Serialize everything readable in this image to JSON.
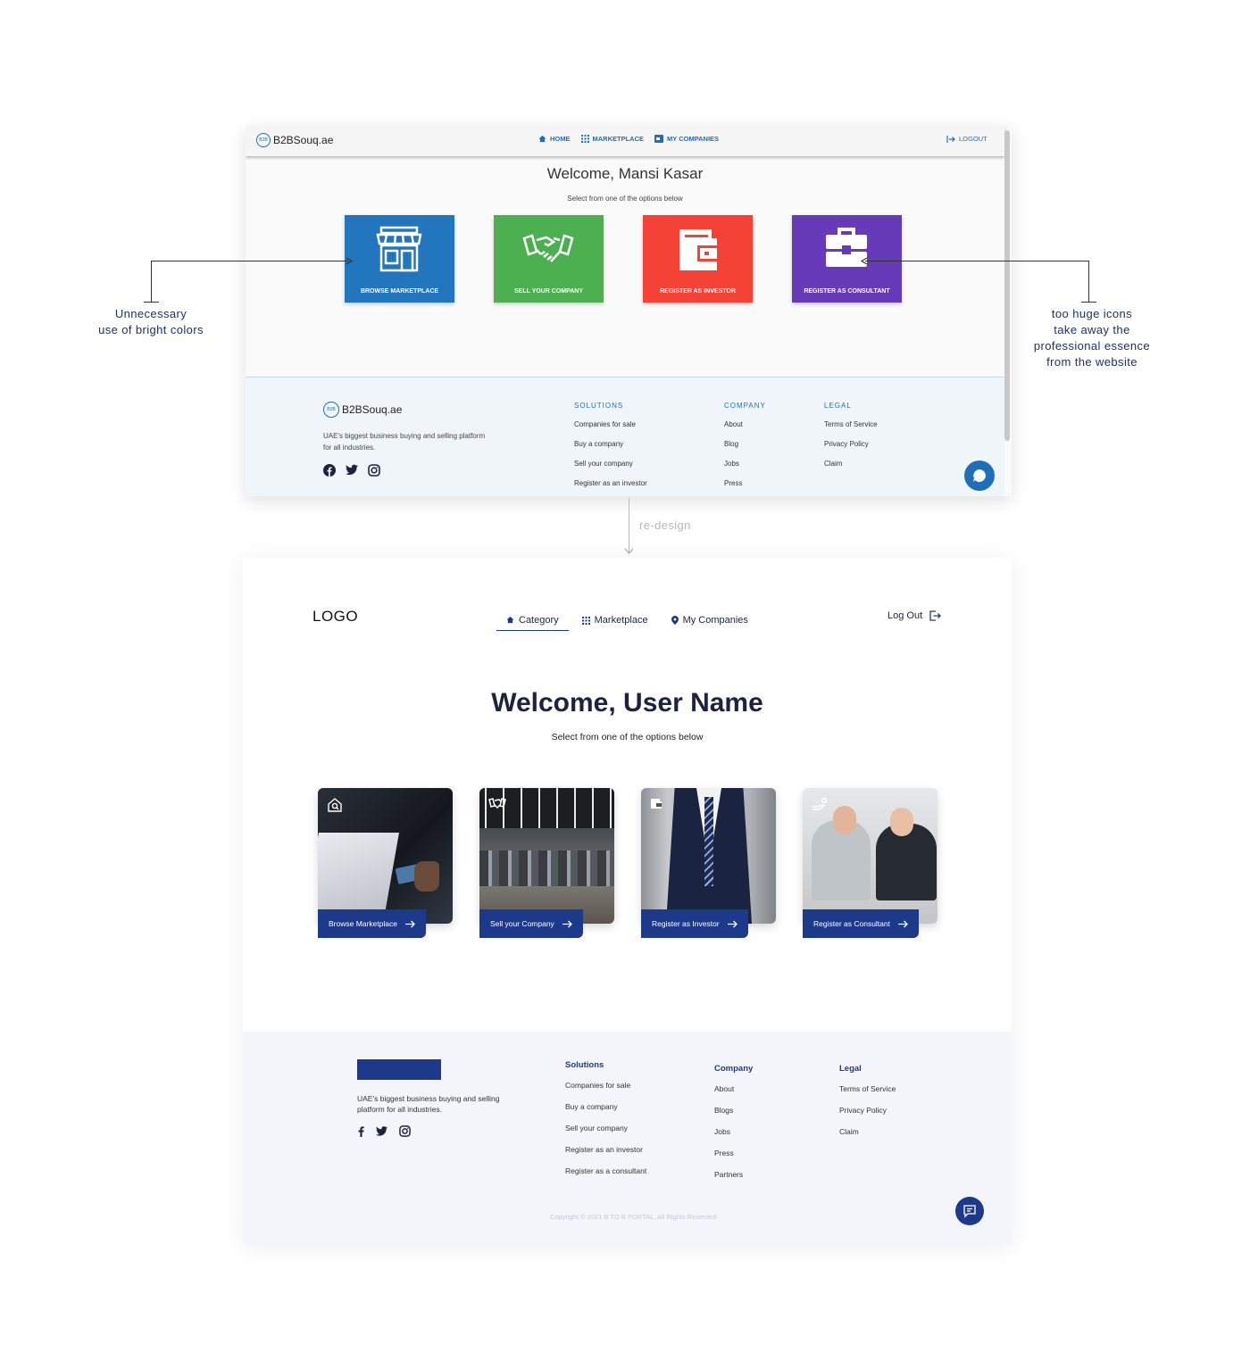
{
  "old_screen": {
    "logo": "B2BSouq.ae",
    "logo_badge": "B2B",
    "nav": {
      "home": "HOME",
      "marketplace": "MARKETPLACE",
      "my_companies": "MY COMPANIES",
      "logout": "LOGOUT"
    },
    "title": "Welcome, Mansi Kasar",
    "subtitle": "Select from one of the options below",
    "tiles": [
      {
        "label": "BROWSE MARKETPLACE",
        "color": "#2176bd",
        "icon": "storefront-icon"
      },
      {
        "label": "SELL YOUR COMPANY",
        "color": "#4caf50",
        "icon": "handshake-icon"
      },
      {
        "label": "REGISTER AS INVESTOR",
        "color": "#f44336",
        "icon": "wallet-icon"
      },
      {
        "label": "REGISTER AS CONSULTANT",
        "color": "#673ab7",
        "icon": "briefcase-icon"
      }
    ],
    "footer": {
      "logo": "B2BSouq.ae",
      "description": "UAE's biggest business buying and selling platform for all industries.",
      "solutions": {
        "heading": "SOLUTIONS",
        "items": [
          "Companies for sale",
          "Buy a company",
          "Sell your company",
          "Register as an investor"
        ]
      },
      "company": {
        "heading": "COMPANY",
        "items": [
          "About",
          "Blog",
          "Jobs",
          "Press"
        ]
      },
      "legal": {
        "heading": "LEGAL",
        "items": [
          "Terms of Service",
          "Privacy Policy",
          "Claim"
        ]
      }
    }
  },
  "annotations": {
    "left": [
      "Unnecessary",
      "use of bright colors"
    ],
    "right": [
      "too huge icons",
      "take away the",
      "professional essence",
      "from the website"
    ],
    "redesign": "re-design"
  },
  "new_screen": {
    "logo": "LOGO",
    "nav": {
      "category": "Category",
      "marketplace": "Marketplace",
      "my_companies": "My Companies",
      "logout": "Log Out"
    },
    "title": "Welcome, User Name",
    "subtitle": "Select from one of the options below",
    "cards": [
      {
        "label": "Browse Marketplace",
        "icon": "house-search-icon"
      },
      {
        "label": "Sell your Company",
        "icon": "handshake-icon"
      },
      {
        "label": "Register as Investor",
        "icon": "wallet-icon"
      },
      {
        "label": "Register as Consultant",
        "icon": "hand-coin-icon"
      }
    ],
    "footer": {
      "description": "UAE's biggest business buying and selling platform for all industries.",
      "solutions": {
        "heading": "Solutions",
        "items": [
          "Companies for sale",
          "Buy a company",
          "Sell your company",
          "Register as an investor",
          "Register as a consultant"
        ]
      },
      "company": {
        "heading": "Company",
        "items": [
          "About",
          "Blogs",
          "Jobs",
          "Press",
          "Partners"
        ]
      },
      "legal": {
        "heading": "Legal",
        "items": [
          "Terms of Service",
          "Privacy Policy",
          "Claim"
        ]
      },
      "copyright": "Copyright © 2021 B TO B PORTAL, All Rights Reserved."
    }
  }
}
